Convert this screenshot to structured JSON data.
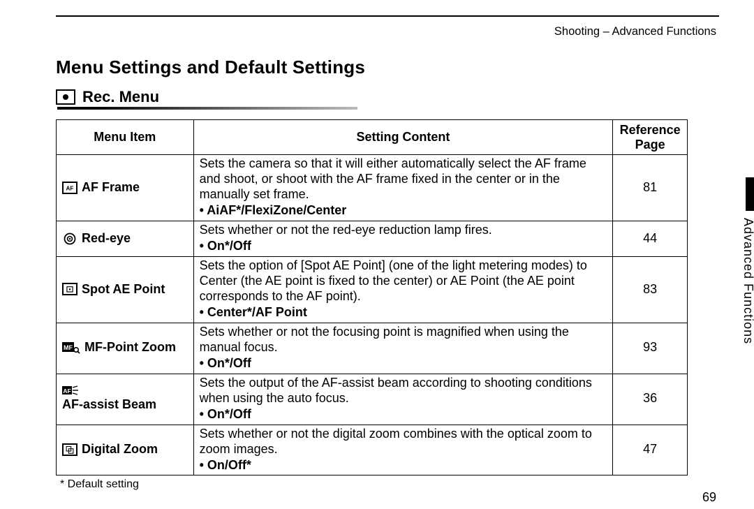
{
  "header": {
    "breadcrumb": "Shooting – Advanced Functions"
  },
  "title": "Menu Settings and Default Settings",
  "section": {
    "icon": "camera-icon",
    "label": "Rec. Menu"
  },
  "table": {
    "headers": {
      "item": "Menu Item",
      "setting": "Setting Content",
      "reference": "Reference Page"
    },
    "rows": [
      {
        "icon": "af-frame-icon",
        "name": "AF Frame",
        "desc": "Sets the camera so that it will either automatically select the AF frame and shoot, or shoot with the AF frame fixed in the center or in the manually set frame.",
        "options": "AiAF*/FlexiZone/Center",
        "ref": "81"
      },
      {
        "icon": "red-eye-icon",
        "name": "Red-eye",
        "desc": "Sets whether or not the red-eye reduction lamp fires.",
        "options": "On*/Off",
        "ref": "44"
      },
      {
        "icon": "spot-ae-icon",
        "name": "Spot AE Point",
        "desc": "Sets the option of [Spot AE Point] (one of the light metering modes) to Center (the AE point is fixed to the center) or AE Point (the AE point corresponds to the AF point).",
        "options": "Center*/AF Point",
        "ref": "83"
      },
      {
        "icon": "mf-zoom-icon",
        "name": "MF-Point Zoom",
        "desc": "Sets whether or not the focusing point is magnified when using the manual focus.",
        "options": "On*/Off",
        "ref": "93"
      },
      {
        "icon": "af-assist-icon",
        "name": "AF-assist Beam",
        "desc": "Sets the output of the AF-assist beam according to shooting conditions when using the auto focus.",
        "options": "On*/Off",
        "ref": "36"
      },
      {
        "icon": "digital-zoom-icon",
        "name": "Digital Zoom",
        "desc": "Sets whether or not the digital zoom combines with the optical zoom to zoom images.",
        "options": "On/Off*",
        "ref": "47"
      }
    ]
  },
  "footnote": "* Default setting",
  "page_number": "69",
  "side_tab": "Advanced Functions"
}
